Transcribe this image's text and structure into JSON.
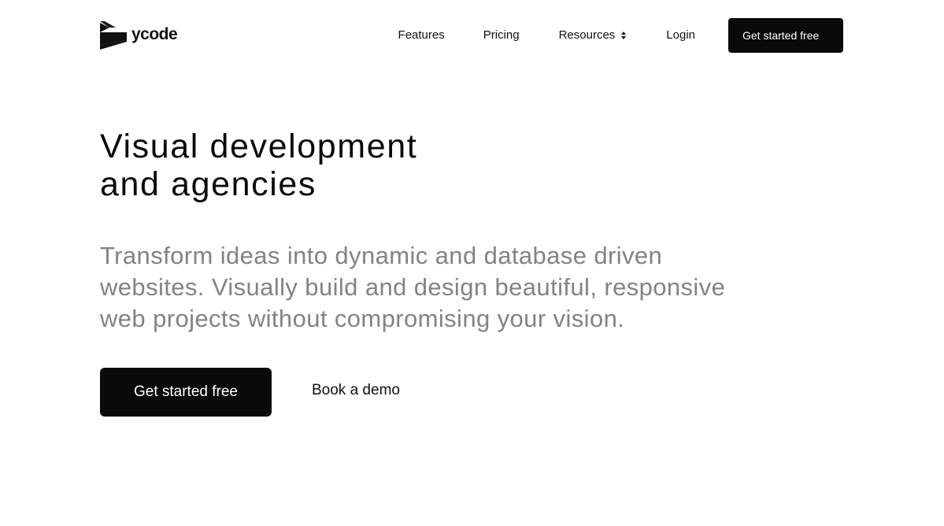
{
  "brand": {
    "name": "ycode",
    "logo_icon": "ycode-logo-mark-icon",
    "color": "#111111"
  },
  "nav": {
    "features": "Features",
    "pricing": "Pricing",
    "resources": "Resources",
    "resources_icon": "sort-up-down-icon",
    "login": "Login",
    "cta": "Get started free"
  },
  "hero": {
    "title_line1": "Visual development",
    "title_line2": "and agencies",
    "subtitle_line1": "Transform ideas into dynamic and database driven",
    "subtitle_line2": "websites. Visually build and design beautiful, responsive",
    "subtitle_line3": "web projects without compromising your vision.",
    "primary_cta": "Get started free",
    "secondary_cta": "Book a demo"
  },
  "colors": {
    "background": "#ffffff",
    "primary_button": "#0a0a0a",
    "primary_button_text": "#ffffff",
    "subtitle_text": "#838383"
  }
}
